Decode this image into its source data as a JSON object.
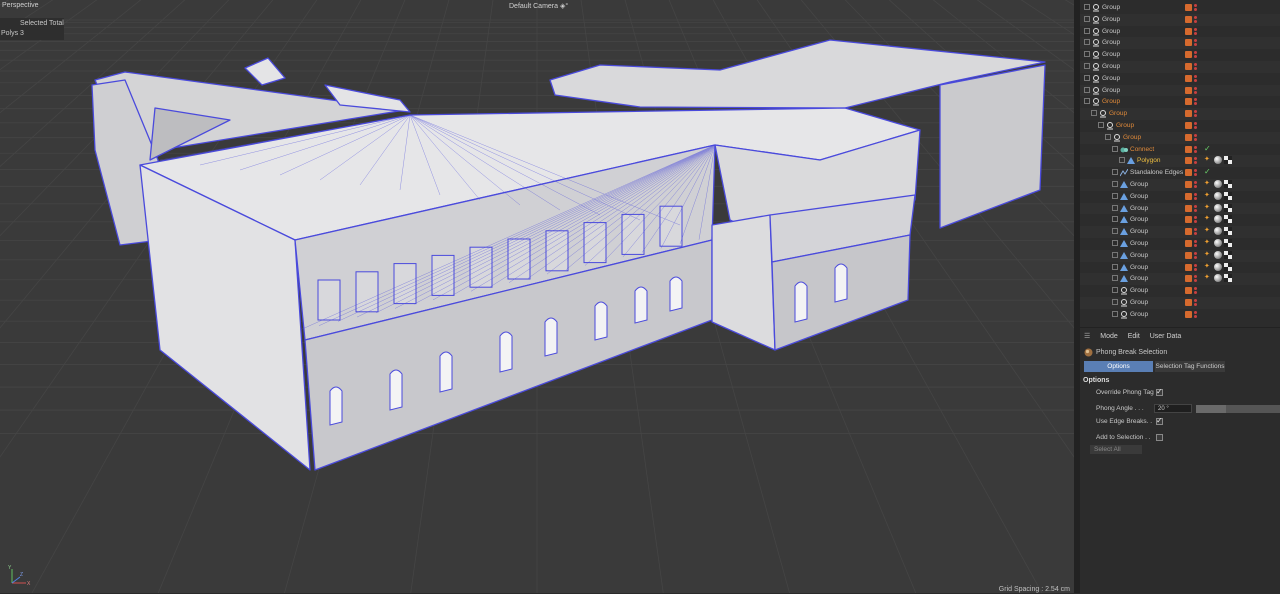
{
  "viewport": {
    "view_name": "Perspective",
    "camera": "Default Camera",
    "camera_suffix": "◈°",
    "hud_title": "Selected Total",
    "hud_key": "Polys",
    "hud_value": "3",
    "grid_spacing": "Grid Spacing : 2.54 cm"
  },
  "object_manager": {
    "rows": [
      {
        "label": "Group",
        "depth": 0,
        "type": "group",
        "color": "#c8c8c8",
        "tags": []
      },
      {
        "label": "Group",
        "depth": 0,
        "type": "group",
        "color": "#c8c8c8",
        "tags": []
      },
      {
        "label": "Group",
        "depth": 0,
        "type": "group",
        "color": "#c8c8c8",
        "tags": []
      },
      {
        "label": "Group",
        "depth": 0,
        "type": "group",
        "color": "#c8c8c8",
        "tags": []
      },
      {
        "label": "Group",
        "depth": 0,
        "type": "group",
        "color": "#c8c8c8",
        "tags": []
      },
      {
        "label": "Group",
        "depth": 0,
        "type": "group",
        "color": "#c8c8c8",
        "tags": []
      },
      {
        "label": "Group",
        "depth": 0,
        "type": "group",
        "color": "#c8c8c8",
        "tags": []
      },
      {
        "label": "Group",
        "depth": 0,
        "type": "group",
        "color": "#c8c8c8",
        "tags": []
      },
      {
        "label": "Group",
        "depth": 0,
        "type": "group",
        "color": "#e08a3a",
        "tags": []
      },
      {
        "label": "Group",
        "depth": 1,
        "type": "group",
        "color": "#e08a3a",
        "tags": []
      },
      {
        "label": "Group",
        "depth": 2,
        "type": "group",
        "color": "#e08a3a",
        "tags": []
      },
      {
        "label": "Group",
        "depth": 3,
        "type": "group",
        "color": "#e08a3a",
        "tags": []
      },
      {
        "label": "Connect",
        "depth": 4,
        "type": "connect",
        "color": "#e08a3a",
        "tags": [
          "check"
        ]
      },
      {
        "label": "Polygon",
        "depth": 5,
        "type": "polygon",
        "color": "#f0c040",
        "tags": [
          "star",
          "phong",
          "sel"
        ]
      },
      {
        "label": "Standalone Edges",
        "depth": 4,
        "type": "spline",
        "color": "#c8c8c8",
        "tags": [
          "check"
        ]
      },
      {
        "label": "Group",
        "depth": 4,
        "type": "polygon",
        "color": "#c8c8c8",
        "tags": [
          "star",
          "phong",
          "sel"
        ]
      },
      {
        "label": "Group",
        "depth": 4,
        "type": "polygon",
        "color": "#c8c8c8",
        "tags": [
          "star",
          "phong",
          "sel"
        ]
      },
      {
        "label": "Group",
        "depth": 4,
        "type": "polygon",
        "color": "#c8c8c8",
        "tags": [
          "star",
          "phong",
          "sel"
        ]
      },
      {
        "label": "Group",
        "depth": 4,
        "type": "polygon",
        "color": "#c8c8c8",
        "tags": [
          "star",
          "phong",
          "sel"
        ]
      },
      {
        "label": "Group",
        "depth": 4,
        "type": "polygon",
        "color": "#c8c8c8",
        "tags": [
          "star",
          "phong",
          "sel"
        ]
      },
      {
        "label": "Group",
        "depth": 4,
        "type": "polygon",
        "color": "#c8c8c8",
        "tags": [
          "star",
          "phong",
          "sel"
        ]
      },
      {
        "label": "Group",
        "depth": 4,
        "type": "polygon",
        "color": "#c8c8c8",
        "tags": [
          "star",
          "phong",
          "sel"
        ]
      },
      {
        "label": "Group",
        "depth": 4,
        "type": "polygon",
        "color": "#c8c8c8",
        "tags": [
          "star",
          "phong",
          "sel"
        ]
      },
      {
        "label": "Group",
        "depth": 4,
        "type": "polygon",
        "color": "#c8c8c8",
        "tags": [
          "star",
          "phong",
          "sel"
        ]
      },
      {
        "label": "Group",
        "depth": 4,
        "type": "group",
        "color": "#c8c8c8",
        "tags": []
      },
      {
        "label": "Group",
        "depth": 4,
        "type": "group",
        "color": "#c8c8c8",
        "tags": []
      },
      {
        "label": "Group",
        "depth": 4,
        "type": "group",
        "color": "#c8c8c8",
        "tags": []
      }
    ]
  },
  "attributes": {
    "menu": [
      "Mode",
      "Edit",
      "User Data"
    ],
    "title": "Phong Break Selection",
    "tabs": {
      "options": "Options",
      "functions": "Selection Tag Functions"
    },
    "section": "Options",
    "override_phong_tag": {
      "label": "Override Phong Tag",
      "checked": true
    },
    "phong_angle": {
      "label": "Phong Angle . . .",
      "value": "20 °",
      "fraction": 0.36
    },
    "use_edge_breaks": {
      "label": "Use Edge Breaks. .",
      "checked": true
    },
    "add_to_selection": {
      "label": "Add to Selection . .",
      "checked": false
    },
    "select_all": "Select All"
  },
  "colors": {
    "accent": "#5a7fb5",
    "orange": "#e08a3a",
    "wire": "#4a4adc"
  }
}
